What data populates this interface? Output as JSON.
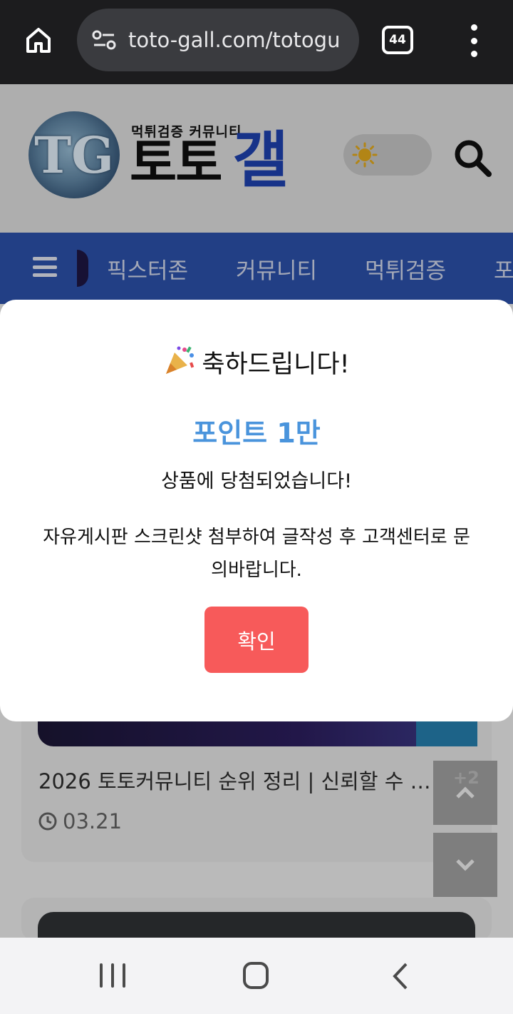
{
  "browser": {
    "url": "toto-gall.com/totogu",
    "tab_count": "44"
  },
  "header": {
    "logo_subtitle": "먹튀검증 커뮤니티",
    "logo_main_black": "토토",
    "logo_main_blue": "갤"
  },
  "nav": {
    "items": [
      {
        "label": "픽스터존"
      },
      {
        "label": "커뮤니티"
      },
      {
        "label": "먹튀검증"
      },
      {
        "label": "포"
      }
    ]
  },
  "content": {
    "card1": {
      "title": "2026 토토커뮤니티 순위 정리 | 신뢰할 수 …",
      "date": "03.21"
    },
    "badge_count": "+2"
  },
  "modal": {
    "title": "축하드립니다!",
    "prize": "포인트 1만",
    "message": "상품에 당첨되었습니다!",
    "info": "자유게시판 스크린샷 첨부하여 글작성 후 고객센터로 문의바랍니다.",
    "confirm_label": "확인"
  },
  "colors": {
    "nav_bg": "#2a4ea3",
    "prize_text": "#4a94dc",
    "confirm_button": "#f75a5a"
  },
  "icons": [
    "home-icon",
    "site-settings-icon",
    "more-options-icon",
    "sun-icon",
    "search-icon",
    "hamburger-icon",
    "party-popper-icon",
    "clock-icon",
    "chevron-up-icon",
    "chevron-down-icon",
    "recent-apps-icon",
    "android-home-icon",
    "back-icon"
  ]
}
